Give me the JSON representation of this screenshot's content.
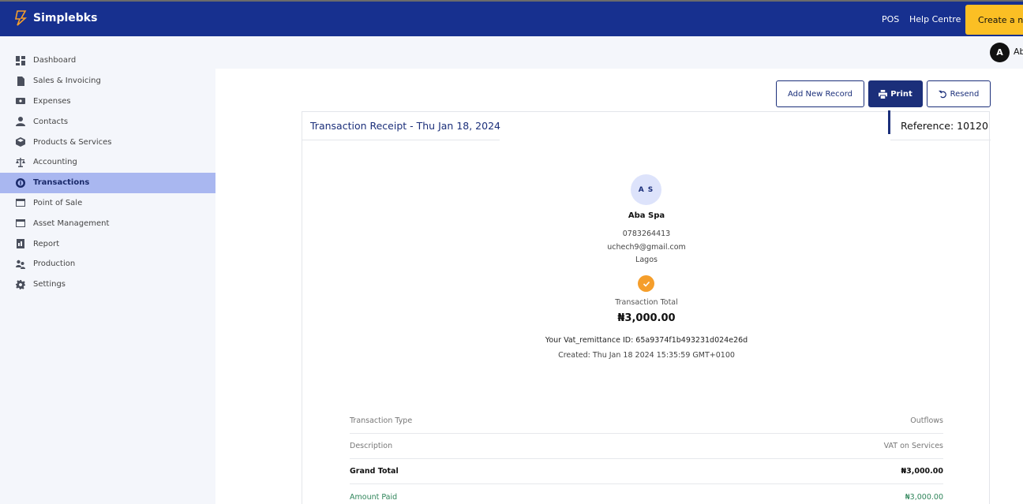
{
  "app": {
    "brand": "Simplebks",
    "nav_links": {
      "pos": "POS",
      "help": "Help Centre"
    },
    "create_button": "Create a ne",
    "user": {
      "initial": "A",
      "name": "Ab"
    }
  },
  "sidebar": {
    "items": [
      {
        "label": "Dashboard",
        "icon": "dashboard-icon"
      },
      {
        "label": "Sales & Invoicing",
        "icon": "document-icon"
      },
      {
        "label": "Expenses",
        "icon": "wallet-icon"
      },
      {
        "label": "Contacts",
        "icon": "person-icon"
      },
      {
        "label": "Products & Services",
        "icon": "box-icon"
      },
      {
        "label": "Accounting",
        "icon": "scale-icon"
      },
      {
        "label": "Transactions",
        "icon": "transactions-icon",
        "active": true
      },
      {
        "label": "Point of Sale",
        "icon": "card-icon"
      },
      {
        "label": "Asset Management",
        "icon": "card-icon"
      },
      {
        "label": "Report",
        "icon": "report-icon"
      },
      {
        "label": "Production",
        "icon": "people-icon"
      },
      {
        "label": "Settings",
        "icon": "gear-icon"
      }
    ]
  },
  "toolbar": {
    "add_label": "Add New Record",
    "print_label": "Print",
    "resend_label": "Resend"
  },
  "receipt": {
    "title": "Transaction Receipt - Thu Jan 18, 2024",
    "reference": "Reference: 10120",
    "client": {
      "initials": "A S",
      "name": "Aba Spa",
      "phone": "0783264413",
      "email": "uchech9@gmail.com",
      "city": "Lagos"
    },
    "total_label": "Transaction Total",
    "total_value": "₦3,000.00",
    "vat_id": "Your Vat_remittance ID: 65a9374f1b493231d024e26d",
    "created": "Created: Thu Jan 18 2024 15:35:59 GMT+0100",
    "rows": [
      {
        "label": "Transaction Type",
        "value": "Outflows"
      },
      {
        "label": "Description",
        "value": "VAT on Services"
      },
      {
        "label": "Grand Total",
        "value": "₦3,000.00"
      },
      {
        "label": "Amount Paid",
        "value": "₦3,000.00"
      }
    ]
  },
  "colors": {
    "header": "#17308f",
    "accent": "#fbbf24",
    "active_item": "#a9b7f0",
    "check": "#f59e2b",
    "paid": "#2f855a"
  }
}
